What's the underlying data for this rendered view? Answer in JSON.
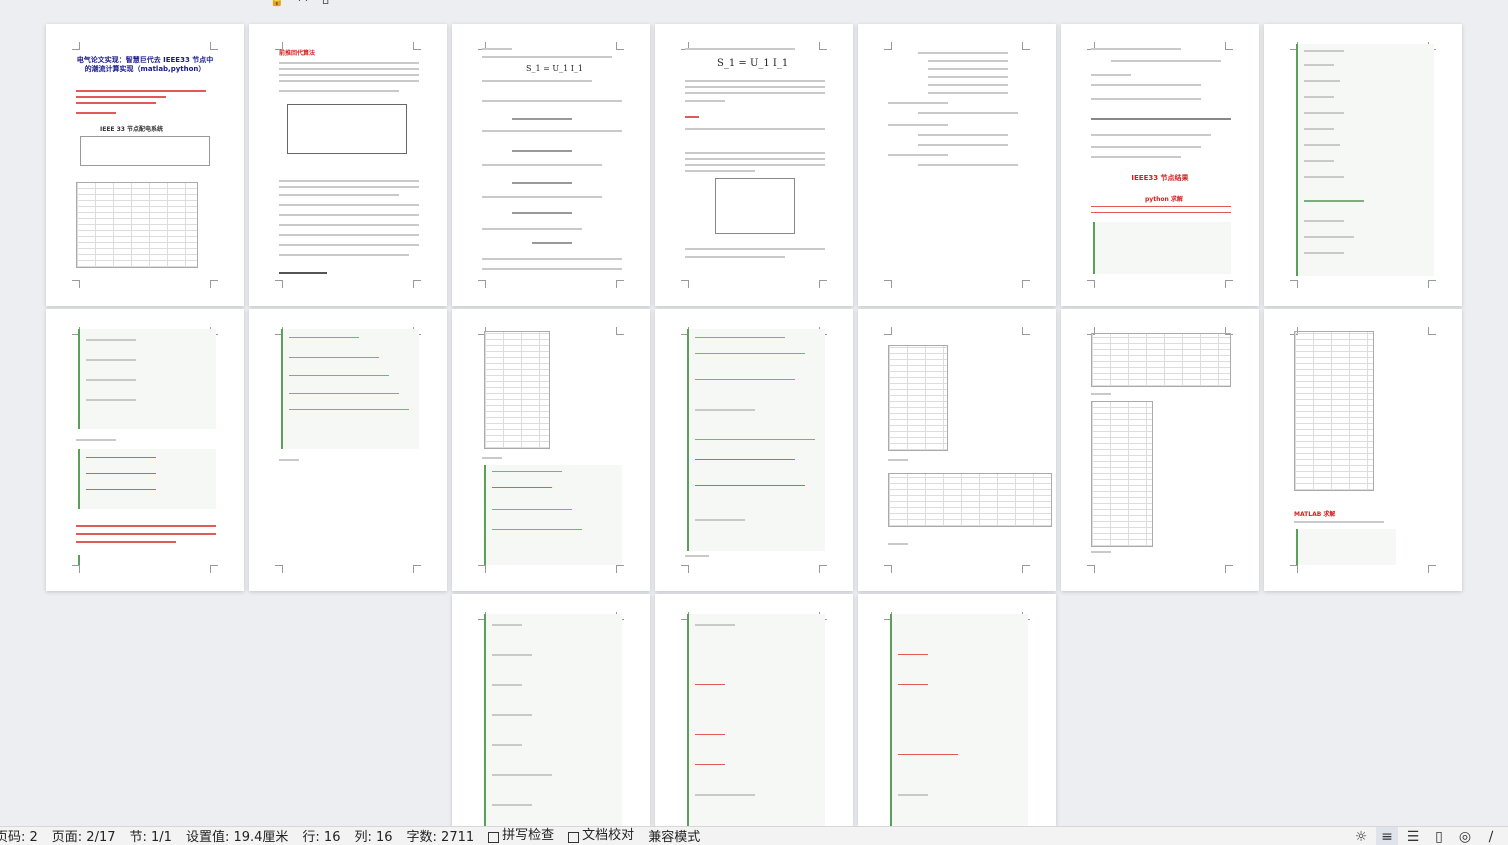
{
  "status": {
    "page_code": "页码: 2",
    "page": "页面: 2/17",
    "section": "节: 1/1",
    "setting": "设置值: 19.4厘米",
    "row": "行: 16",
    "col": "列: 16",
    "words": "字数: 2711",
    "spell_check": "拼写检查",
    "doc_check": "文档校对",
    "compat": "兼容模式"
  },
  "pages": [
    {
      "title": "电气论文实现：智慧巨代去 IEEE33 节点中的潮流计算实现（matlab,python）",
      "subtitle": "IEEE 33 节点配电系统"
    },
    {
      "title": "前推回代算法"
    },
    {
      "formula": "S_1 = U_1 I_1"
    },
    {
      "formula": "S_1 = U_1 I_1"
    },
    {},
    {
      "title": "IEEE33 节点结果",
      "sub": "python 求解"
    },
    {},
    {},
    {},
    {},
    {},
    {},
    {},
    {
      "title": "MATLAB 求解"
    },
    {},
    {},
    {}
  ],
  "colors": {
    "accent": "#d21f1f",
    "code_bar": "#5aa05a",
    "title_blue": "#1a1a8a"
  },
  "icons": [
    "settings-icon",
    "print-layout-icon",
    "outline-icon",
    "read-icon",
    "web-icon",
    "zoom-icon"
  ]
}
